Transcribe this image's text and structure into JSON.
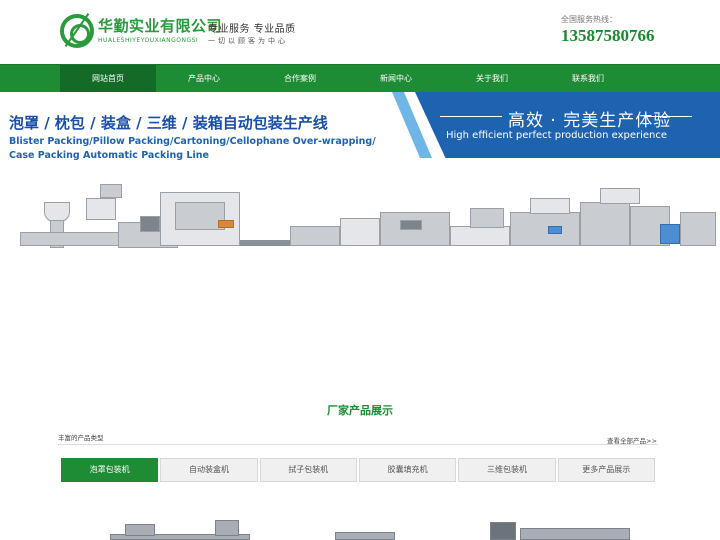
{
  "header": {
    "company_cn": "华勤实业有限公司",
    "company_en": "HUALESHIYEYOUXIANGONGSI",
    "slogan1": "专业服务   专业品质",
    "slogan2": "一切以顾客为中心",
    "hotline_label": "全国服务热线：",
    "hotline_number": "13587580766"
  },
  "nav": {
    "items": [
      {
        "label": "网站首页",
        "active": true
      },
      {
        "label": "产品中心"
      },
      {
        "label": "合作案例"
      },
      {
        "label": "新闻中心"
      },
      {
        "label": "关于我们"
      },
      {
        "label": "联系我们"
      }
    ]
  },
  "banner": {
    "title": "泡罩 / 枕包 / 装盒 / 三维 / 装箱自动包装生产线",
    "en_line1": "Blister Packing/Pillow Packing/Cartoning/Cellophane Over-wrapping/",
    "en_line2": "Case Packing Automatic Packing Line",
    "slogan_cn": "高效 · 完美生产体验",
    "slogan_en": "High efficient perfect production experience"
  },
  "products": {
    "section_title": "厂家产品展示",
    "subtitle": "丰富的产品类型",
    "view_all": "查看全部产品>>",
    "tabs": [
      {
        "label": "泡罩包装机",
        "active": true
      },
      {
        "label": "自动装盒机"
      },
      {
        "label": "拭子包装机"
      },
      {
        "label": "胶囊填充机"
      },
      {
        "label": "三维包装机"
      },
      {
        "label": "更多产品展示"
      }
    ]
  },
  "colors": {
    "brand_green": "#1e8b35",
    "banner_blue": "#1e63b0"
  }
}
